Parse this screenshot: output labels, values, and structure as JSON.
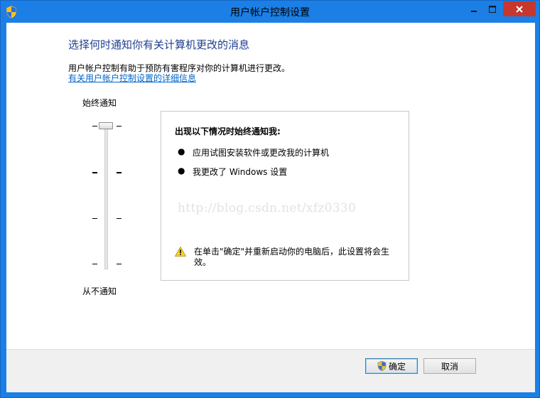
{
  "window": {
    "title": "用户帐户控制设置"
  },
  "main": {
    "heading": "选择何时通知你有关计算机更改的消息",
    "description": "用户帐户控制有助于预防有害程序对你的计算机进行更改。",
    "info_link": "有关用户帐户控制设置的详细信息"
  },
  "slider": {
    "top_label": "始终通知",
    "bottom_label": "从不通知",
    "levels": 4,
    "selected_level": 4
  },
  "panel": {
    "title": "出现以下情况时始终通知我:",
    "bullets": [
      "应用试图安装软件或更改我的计算机",
      "我更改了 Windows 设置"
    ],
    "watermark": "http://blog.csdn.net/xfz0330",
    "warning": "在单击\"确定\"并重新启动你的电脑后，此设置将会生效。"
  },
  "buttons": {
    "ok_label": "确定",
    "cancel_label": "取消"
  },
  "colors": {
    "frame": "#1b7fe6",
    "close_button": "#c7372d",
    "heading": "#1e3e8f",
    "link": "#0066cc"
  },
  "icons": {
    "title": "uac-shield-icon",
    "ok": "uac-shield-icon",
    "warning": "warning-triangle-icon"
  }
}
